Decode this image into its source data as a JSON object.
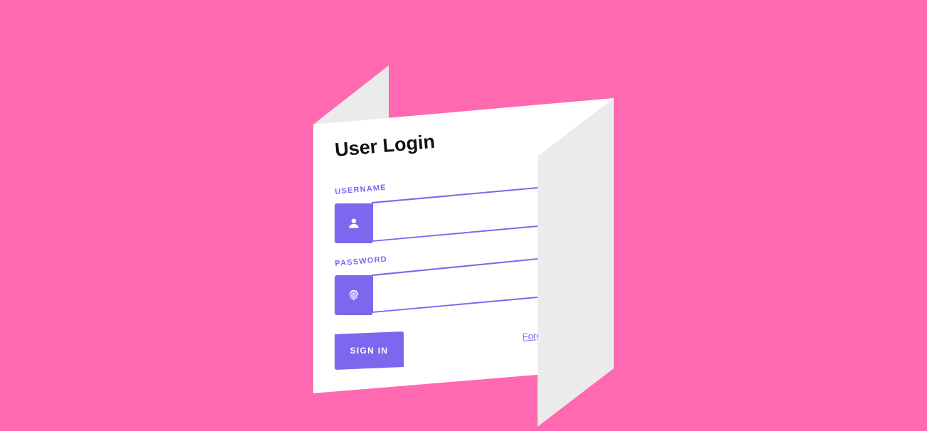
{
  "login": {
    "title": "User Login",
    "username_label": "USERNAME",
    "username_value": "",
    "password_label": "PASSWORD",
    "password_value": "",
    "signin_label": "SIGN IN",
    "forgot_label": "Forgot password?"
  },
  "icons": {
    "username": "user-icon",
    "password": "fingerprint-icon"
  },
  "colors": {
    "background": "#ff69b0",
    "accent": "#7b68ee",
    "card": "#ffffff",
    "fold": "#ebebeb"
  }
}
